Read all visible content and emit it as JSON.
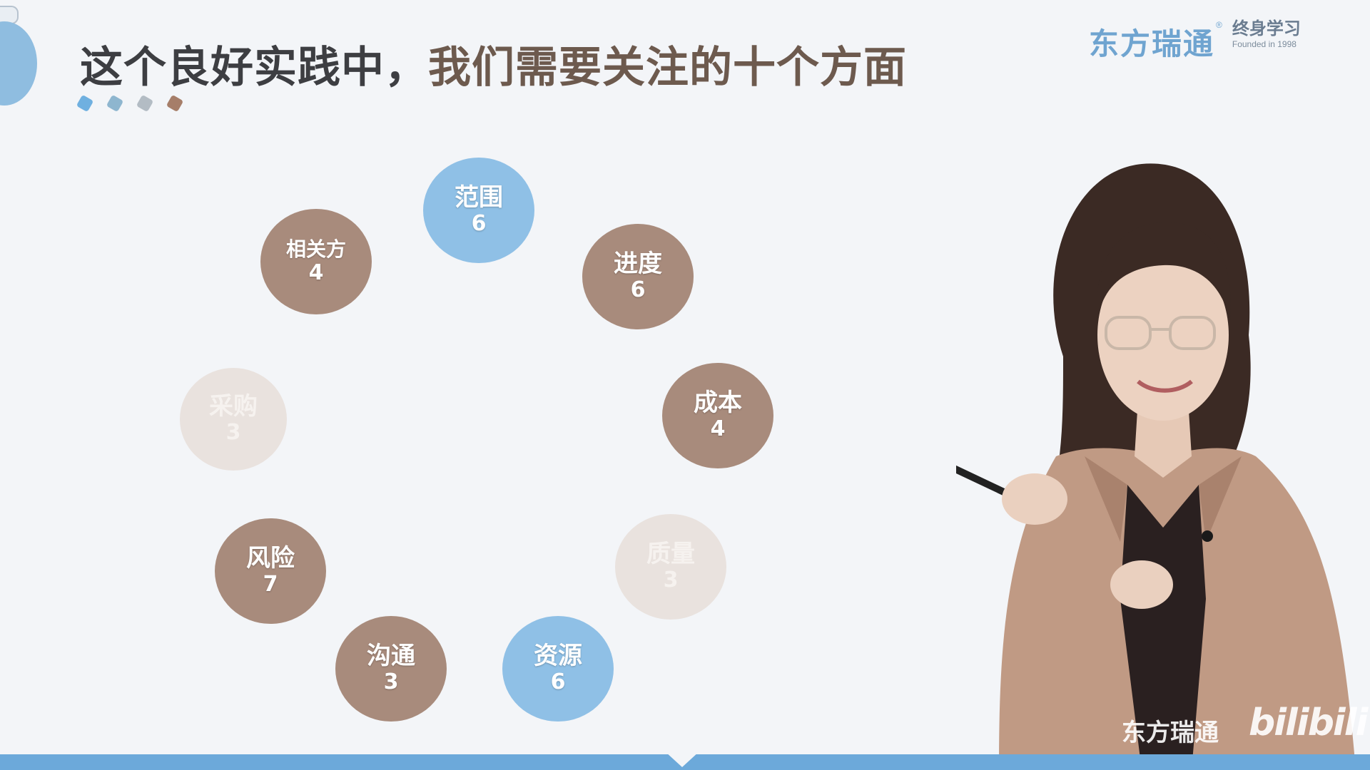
{
  "slide": {
    "title_part1": "这个良好实践中，",
    "title_part2": "我们需要关注的十个方面"
  },
  "logo": {
    "name": "东方瑞通",
    "registered": "®",
    "sub_line1": "终身学习",
    "sub_line2": "Founded in 1998"
  },
  "dot_colors": [
    "#6fb0e0",
    "#8eb6cf",
    "#b3bcc4",
    "#a67e69"
  ],
  "bubbles": [
    {
      "label": "范围",
      "count": "6",
      "color": "blue"
    },
    {
      "label": "进度",
      "count": "6",
      "color": "brown"
    },
    {
      "label": "成本",
      "count": "4",
      "color": "brown"
    },
    {
      "label": "质量",
      "count": "3",
      "color": "faded"
    },
    {
      "label": "资源",
      "count": "6",
      "color": "blue"
    },
    {
      "label": "沟通",
      "count": "3",
      "color": "brown"
    },
    {
      "label": "风险",
      "count": "7",
      "color": "brown"
    },
    {
      "label": "采购",
      "count": "3",
      "color": "faded"
    },
    {
      "label": "相关方",
      "count": "4",
      "color": "brown"
    }
  ],
  "watermark": {
    "name": "东方瑞通",
    "site": "bilibili"
  }
}
